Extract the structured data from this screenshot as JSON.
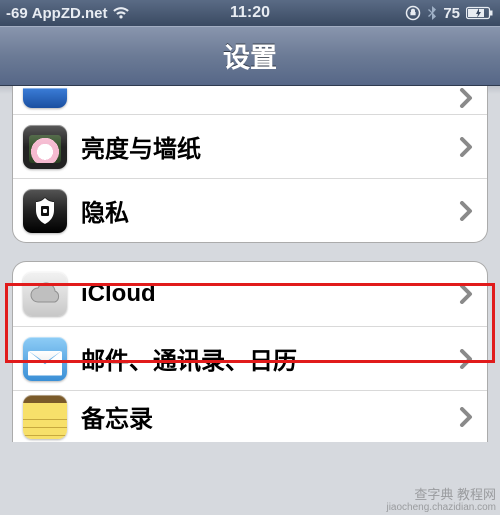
{
  "status": {
    "signal": "-69",
    "carrier": "AppZD.net",
    "time": "11:20",
    "battery": "75"
  },
  "header": {
    "title": "设置"
  },
  "group1": {
    "items": [
      {
        "label": ""
      },
      {
        "label": "亮度与墙纸"
      },
      {
        "label": "隐私"
      }
    ]
  },
  "group2": {
    "items": [
      {
        "label": "iCloud"
      },
      {
        "label": "邮件、通讯录、日历"
      },
      {
        "label": "备忘录"
      }
    ]
  },
  "watermark": {
    "line1": "查字典 教程网",
    "line2": "jiaocheng.chazidian.com"
  }
}
